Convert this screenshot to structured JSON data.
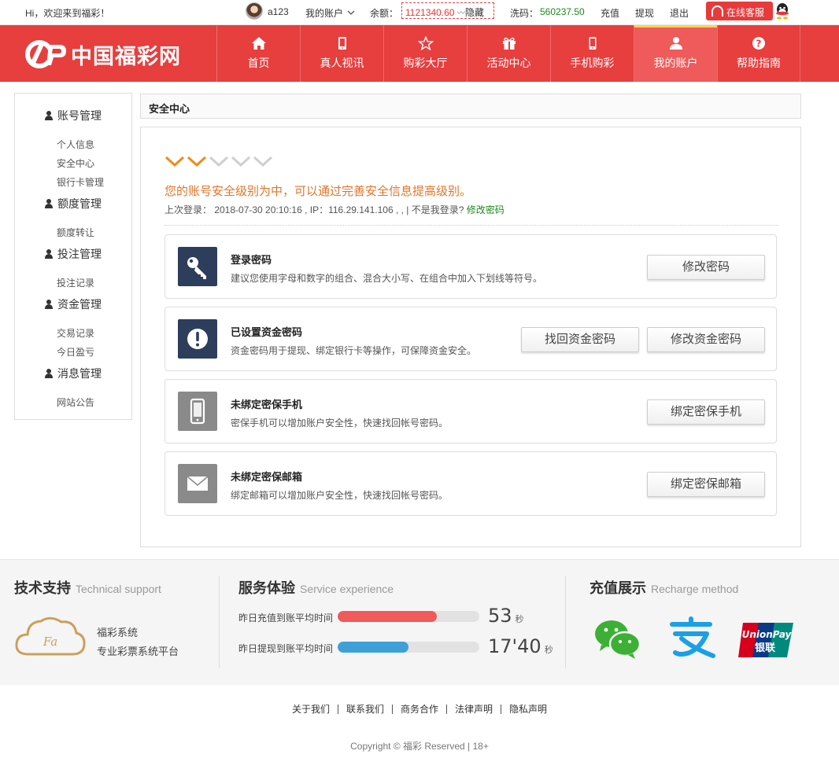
{
  "topbar": {
    "greeting": "Hi，欢迎来到福彩！",
    "username": "a123",
    "my_account": "我的账户",
    "balance_label": "余额：",
    "balance_value": "1121340.60",
    "hide_label": "隐藏",
    "wash_label": "洗码：",
    "wash_value": "560237.50",
    "recharge": "充值",
    "withdraw": "提现",
    "logout": "退出",
    "online_service": "在线客服"
  },
  "header": {
    "logo_text": "中国福彩网",
    "nav": [
      {
        "label": "首页",
        "icon": "home-icon"
      },
      {
        "label": "真人视讯",
        "icon": "tablet-icon"
      },
      {
        "label": "购彩大厅",
        "icon": "star-icon"
      },
      {
        "label": "活动中心",
        "icon": "gift-icon"
      },
      {
        "label": "手机购彩",
        "icon": "phone-icon"
      },
      {
        "label": "我的账户",
        "icon": "user-icon"
      },
      {
        "label": "帮助指南",
        "icon": "help-icon"
      }
    ]
  },
  "sidebar": {
    "groups": [
      {
        "title": "账号管理",
        "items": [
          "个人信息",
          "安全中心",
          "银行卡管理"
        ]
      },
      {
        "title": "额度管理",
        "items": [
          "额度转让"
        ]
      },
      {
        "title": "投注管理",
        "items": [
          "投注记录"
        ]
      },
      {
        "title": "资金管理",
        "items": [
          "交易记录",
          "今日盈亏"
        ]
      },
      {
        "title": "消息管理",
        "items": [
          "网站公告"
        ]
      }
    ]
  },
  "main": {
    "breadcrumb": "安全中心",
    "security_level_text": "您的账号安全级别为中，可以通过完善安全信息提高级别。",
    "security_level": 2,
    "security_level_max": 5,
    "last_login_text": "上次登录： 2018-07-30 20:10:16 , IP：116.29.141.106 , , | 不是我登录?",
    "last_login_link": "修改密码",
    "cards": [
      {
        "title": "登录密码",
        "desc": "建议您使用字母和数字的组合、混合大小写、在组合中加入下划线等符号。",
        "icon": "key-icon",
        "buttons": [
          "修改密码"
        ]
      },
      {
        "title": "已设置资金密码",
        "desc": "资金密码用于提现、绑定银行卡等操作，可保障资金安全。",
        "icon": "exclamation-icon",
        "buttons": [
          "找回资金密码",
          "修改资金密码"
        ]
      },
      {
        "title": "未绑定密保手机",
        "desc": "密保手机可以增加账户安全性，快速找回帐号密码。",
        "icon": "mobile-icon",
        "buttons": [
          "绑定密保手机"
        ]
      },
      {
        "title": "未绑定密保邮箱",
        "desc": "绑定邮箱可以增加账户安全性，快速找回帐号密码。",
        "icon": "mail-icon",
        "buttons": [
          "绑定密保邮箱"
        ]
      }
    ]
  },
  "footer": {
    "tech": {
      "title": "技术支持",
      "en": "Technical support",
      "line1": "福彩系统",
      "line2": "专业彩票系统平台",
      "logo_text": "Fa"
    },
    "service": {
      "title": "服务体验",
      "en": "Service experience",
      "bars": [
        {
          "label": "昨日充值到账平均时间",
          "value": "53",
          "unit": "秒",
          "fill": 0.7,
          "color": "#f05a5a"
        },
        {
          "label": "昨日提现到账平均时间",
          "value": "17'40",
          "unit": "秒",
          "fill": 0.5,
          "color": "#3fa0d8"
        }
      ]
    },
    "recharge": {
      "title": "充值展示",
      "en": "Recharge method",
      "methods": [
        "wechat-pay-icon",
        "alipay-icon",
        "unionpay-icon"
      ],
      "unionpay_text": "UnionPay",
      "unionpay_cn": "银联"
    },
    "links": [
      "关于我们",
      "联系我们",
      "商务合作",
      "法律声明",
      "隐私声明"
    ],
    "copyright": "Copyright © 福彩 Reserved | 18+"
  },
  "colors": {
    "brand_red": "#e73e3e",
    "level_orange": "#f08a1c",
    "link_green": "#1a8a1a"
  }
}
